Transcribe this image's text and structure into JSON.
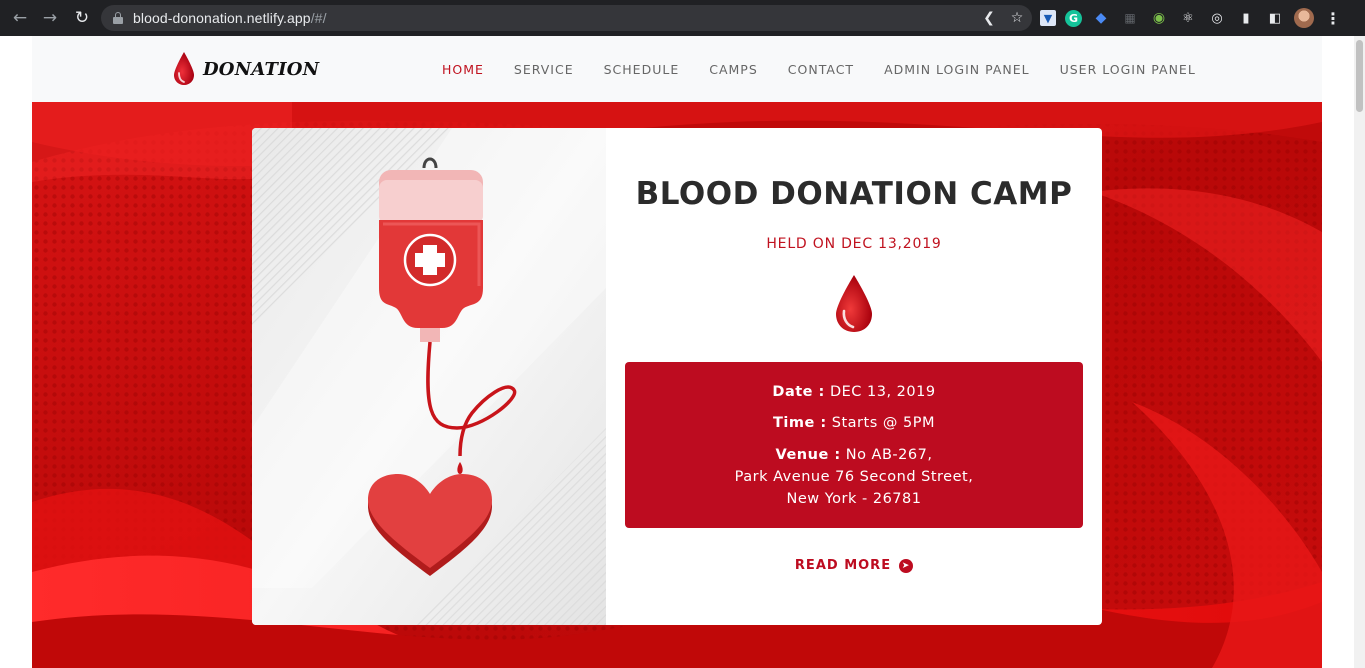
{
  "browser": {
    "url_host": "blood-dononation.netlify.app",
    "url_path": "/#/",
    "icons": [
      "back-icon",
      "forward-icon",
      "reload-icon",
      "lock-icon",
      "share-icon",
      "star-icon",
      "extensions-icon",
      "sidepanel-icon",
      "menu-icon"
    ]
  },
  "nav": {
    "brand": "DONATION",
    "items": [
      {
        "label": "HOME",
        "active": true
      },
      {
        "label": "SERVICE"
      },
      {
        "label": "SCHEDULE"
      },
      {
        "label": "CAMPS"
      },
      {
        "label": "CONTACT"
      },
      {
        "label": "ADMIN LOGIN PANEL"
      },
      {
        "label": "USER LOGIN PANEL"
      }
    ]
  },
  "camp": {
    "title": "BLOOD DONATION CAMP",
    "held_on": "HELD ON DEC 13,2019",
    "date_label": "Date :",
    "date_value": "DEC 13, 2019",
    "time_label": "Time :",
    "time_value": "Starts @ 5PM",
    "venue_label": "Venue :",
    "venue_line1": "No AB-267,",
    "venue_line2": "Park Avenue 76 Second Street,",
    "venue_line3": "New York - 26781",
    "read_more": "READ MORE"
  },
  "colors": {
    "accent": "#bd0c20",
    "hero_red": "#c20d0d",
    "nav_bg": "#f8f9fa"
  }
}
